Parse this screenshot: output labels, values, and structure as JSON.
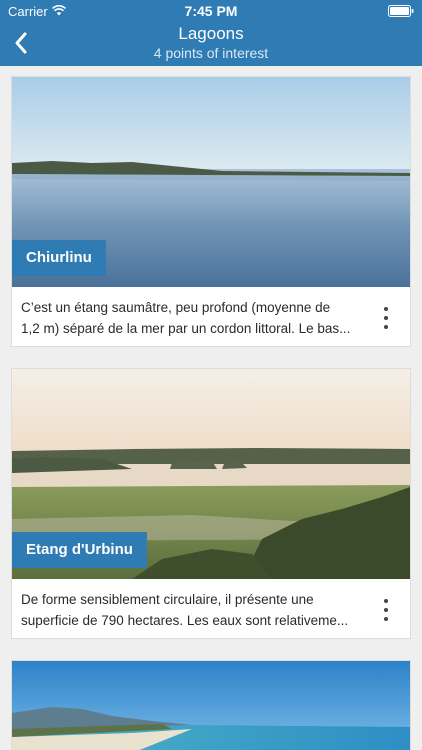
{
  "status_bar": {
    "carrier": "Carrier",
    "time": "7:45 PM"
  },
  "nav": {
    "title": "Lagoons",
    "subtitle": "4 points of interest",
    "back_icon": "chevron-left-icon"
  },
  "colors": {
    "header": "#2f7bb4",
    "label_bg": "#2f7bb4",
    "background": "#efefef"
  },
  "items": [
    {
      "name": "Chiurlinu",
      "description_lines": [
        "C’est un étang saumâtre, peu profond (moyenne de",
        "1,2 m) séparé de la mer par un cordon littoral. Le bas..."
      ]
    },
    {
      "name": "Etang d'Urbinu",
      "description_lines": [
        "De forme sensiblement circulaire, il présente une",
        "superficie de 790 hectares. Les eaux sont relativeme..."
      ]
    }
  ]
}
